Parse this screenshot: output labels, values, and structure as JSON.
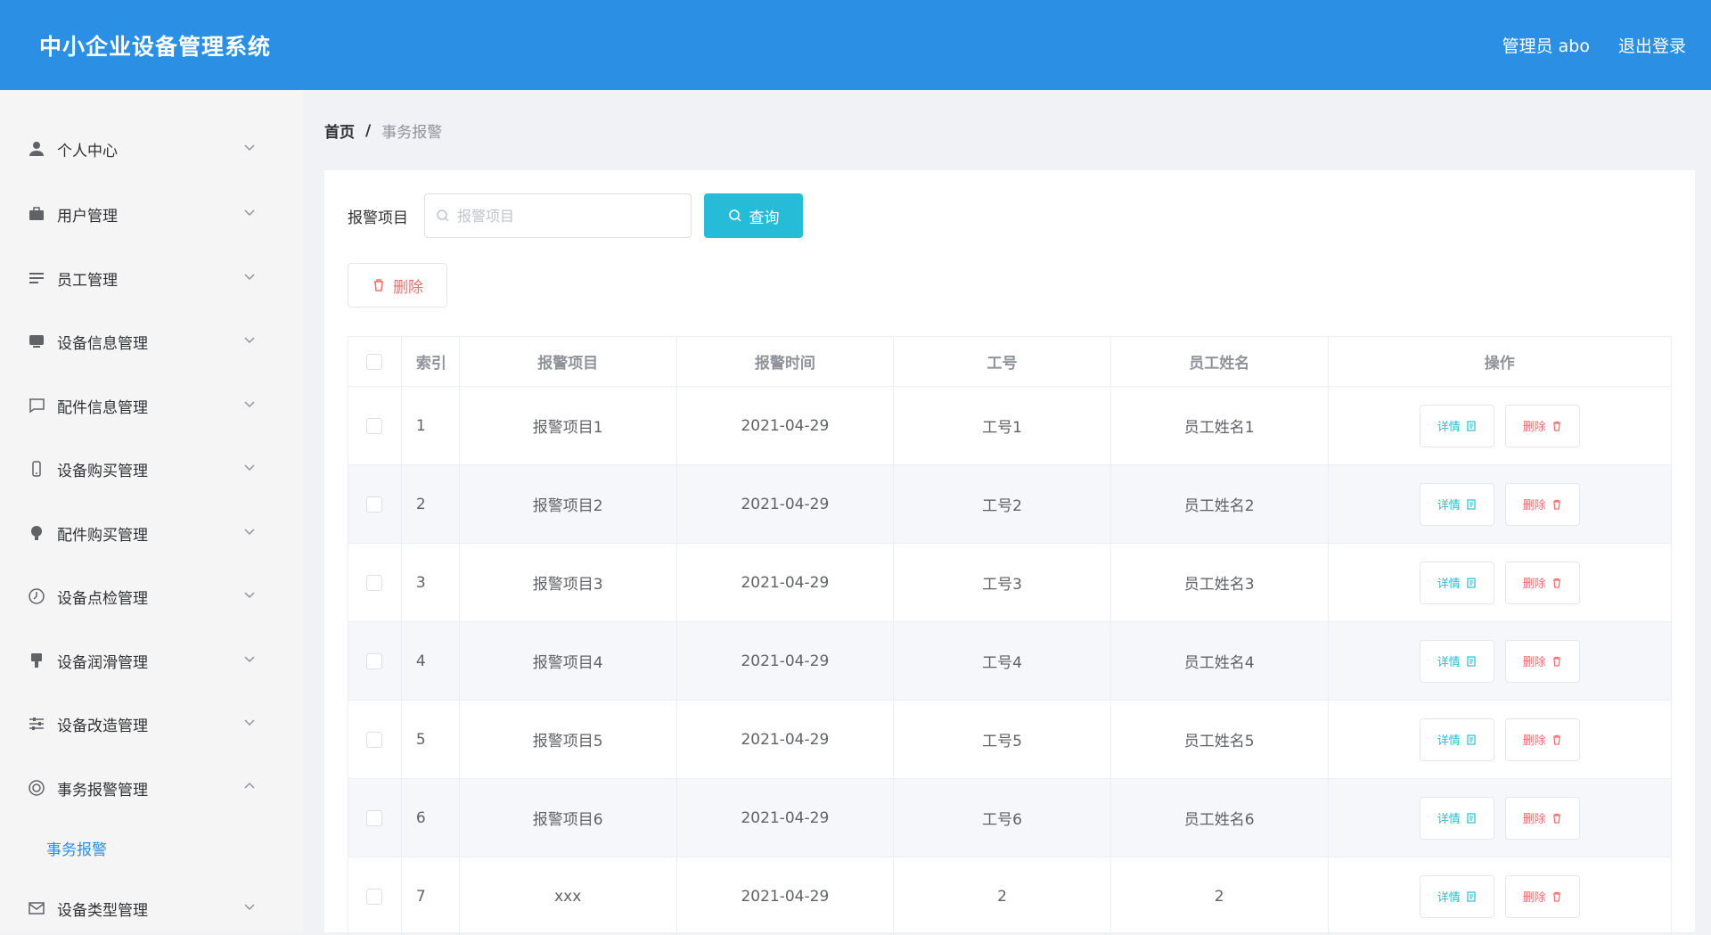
{
  "header": {
    "title": "中小企业设备管理系统",
    "user_label": "管理员 abo",
    "logout_label": "退出登录"
  },
  "sidebar": {
    "items": [
      {
        "label": "个人中心",
        "icon": "user-icon"
      },
      {
        "label": "用户管理",
        "icon": "briefcase-icon"
      },
      {
        "label": "员工管理",
        "icon": "list-icon"
      },
      {
        "label": "设备信息管理",
        "icon": "device-icon"
      },
      {
        "label": "配件信息管理",
        "icon": "chat-icon"
      },
      {
        "label": "设备购买管理",
        "icon": "phone-icon"
      },
      {
        "label": "配件购买管理",
        "icon": "bulb-icon"
      },
      {
        "label": "设备点检管理",
        "icon": "clock-icon"
      },
      {
        "label": "设备润滑管理",
        "icon": "stamp-icon"
      },
      {
        "label": "设备改造管理",
        "icon": "sliders-icon"
      },
      {
        "label": "事务报警管理",
        "icon": "target-icon"
      },
      {
        "label": "设备类型管理",
        "icon": "mail-icon"
      }
    ],
    "active_sub_item": "事务报警"
  },
  "breadcrumb": {
    "home": "首页",
    "separator": "/",
    "current": "事务报警"
  },
  "search": {
    "label": "报警项目",
    "placeholder": "报警项目",
    "value": "",
    "query_label": "查询"
  },
  "toolbar": {
    "delete_label": "删除"
  },
  "table": {
    "headers": {
      "index": "索引",
      "item": "报警项目",
      "time": "报警时间",
      "no": "工号",
      "name": "员工姓名",
      "ops": "操作"
    },
    "detail_label": "详情",
    "remove_label": "删除",
    "rows": [
      {
        "index": "1",
        "item": "报警项目1",
        "time": "2021-04-29",
        "no": "工号1",
        "name": "员工姓名1"
      },
      {
        "index": "2",
        "item": "报警项目2",
        "time": "2021-04-29",
        "no": "工号2",
        "name": "员工姓名2"
      },
      {
        "index": "3",
        "item": "报警项目3",
        "time": "2021-04-29",
        "no": "工号3",
        "name": "员工姓名3"
      },
      {
        "index": "4",
        "item": "报警项目4",
        "time": "2021-04-29",
        "no": "工号4",
        "name": "员工姓名4"
      },
      {
        "index": "5",
        "item": "报警项目5",
        "time": "2021-04-29",
        "no": "工号5",
        "name": "员工姓名5"
      },
      {
        "index": "6",
        "item": "报警项目6",
        "time": "2021-04-29",
        "no": "工号6",
        "name": "员工姓名6"
      },
      {
        "index": "7",
        "item": "xxx",
        "time": "2021-04-29",
        "no": "2",
        "name": "2"
      }
    ]
  },
  "colors": {
    "header_bg": "#2b8fe3",
    "query_btn": "#26bcd7",
    "danger": "#f56c6c",
    "active_link": "#2b8fe3"
  }
}
